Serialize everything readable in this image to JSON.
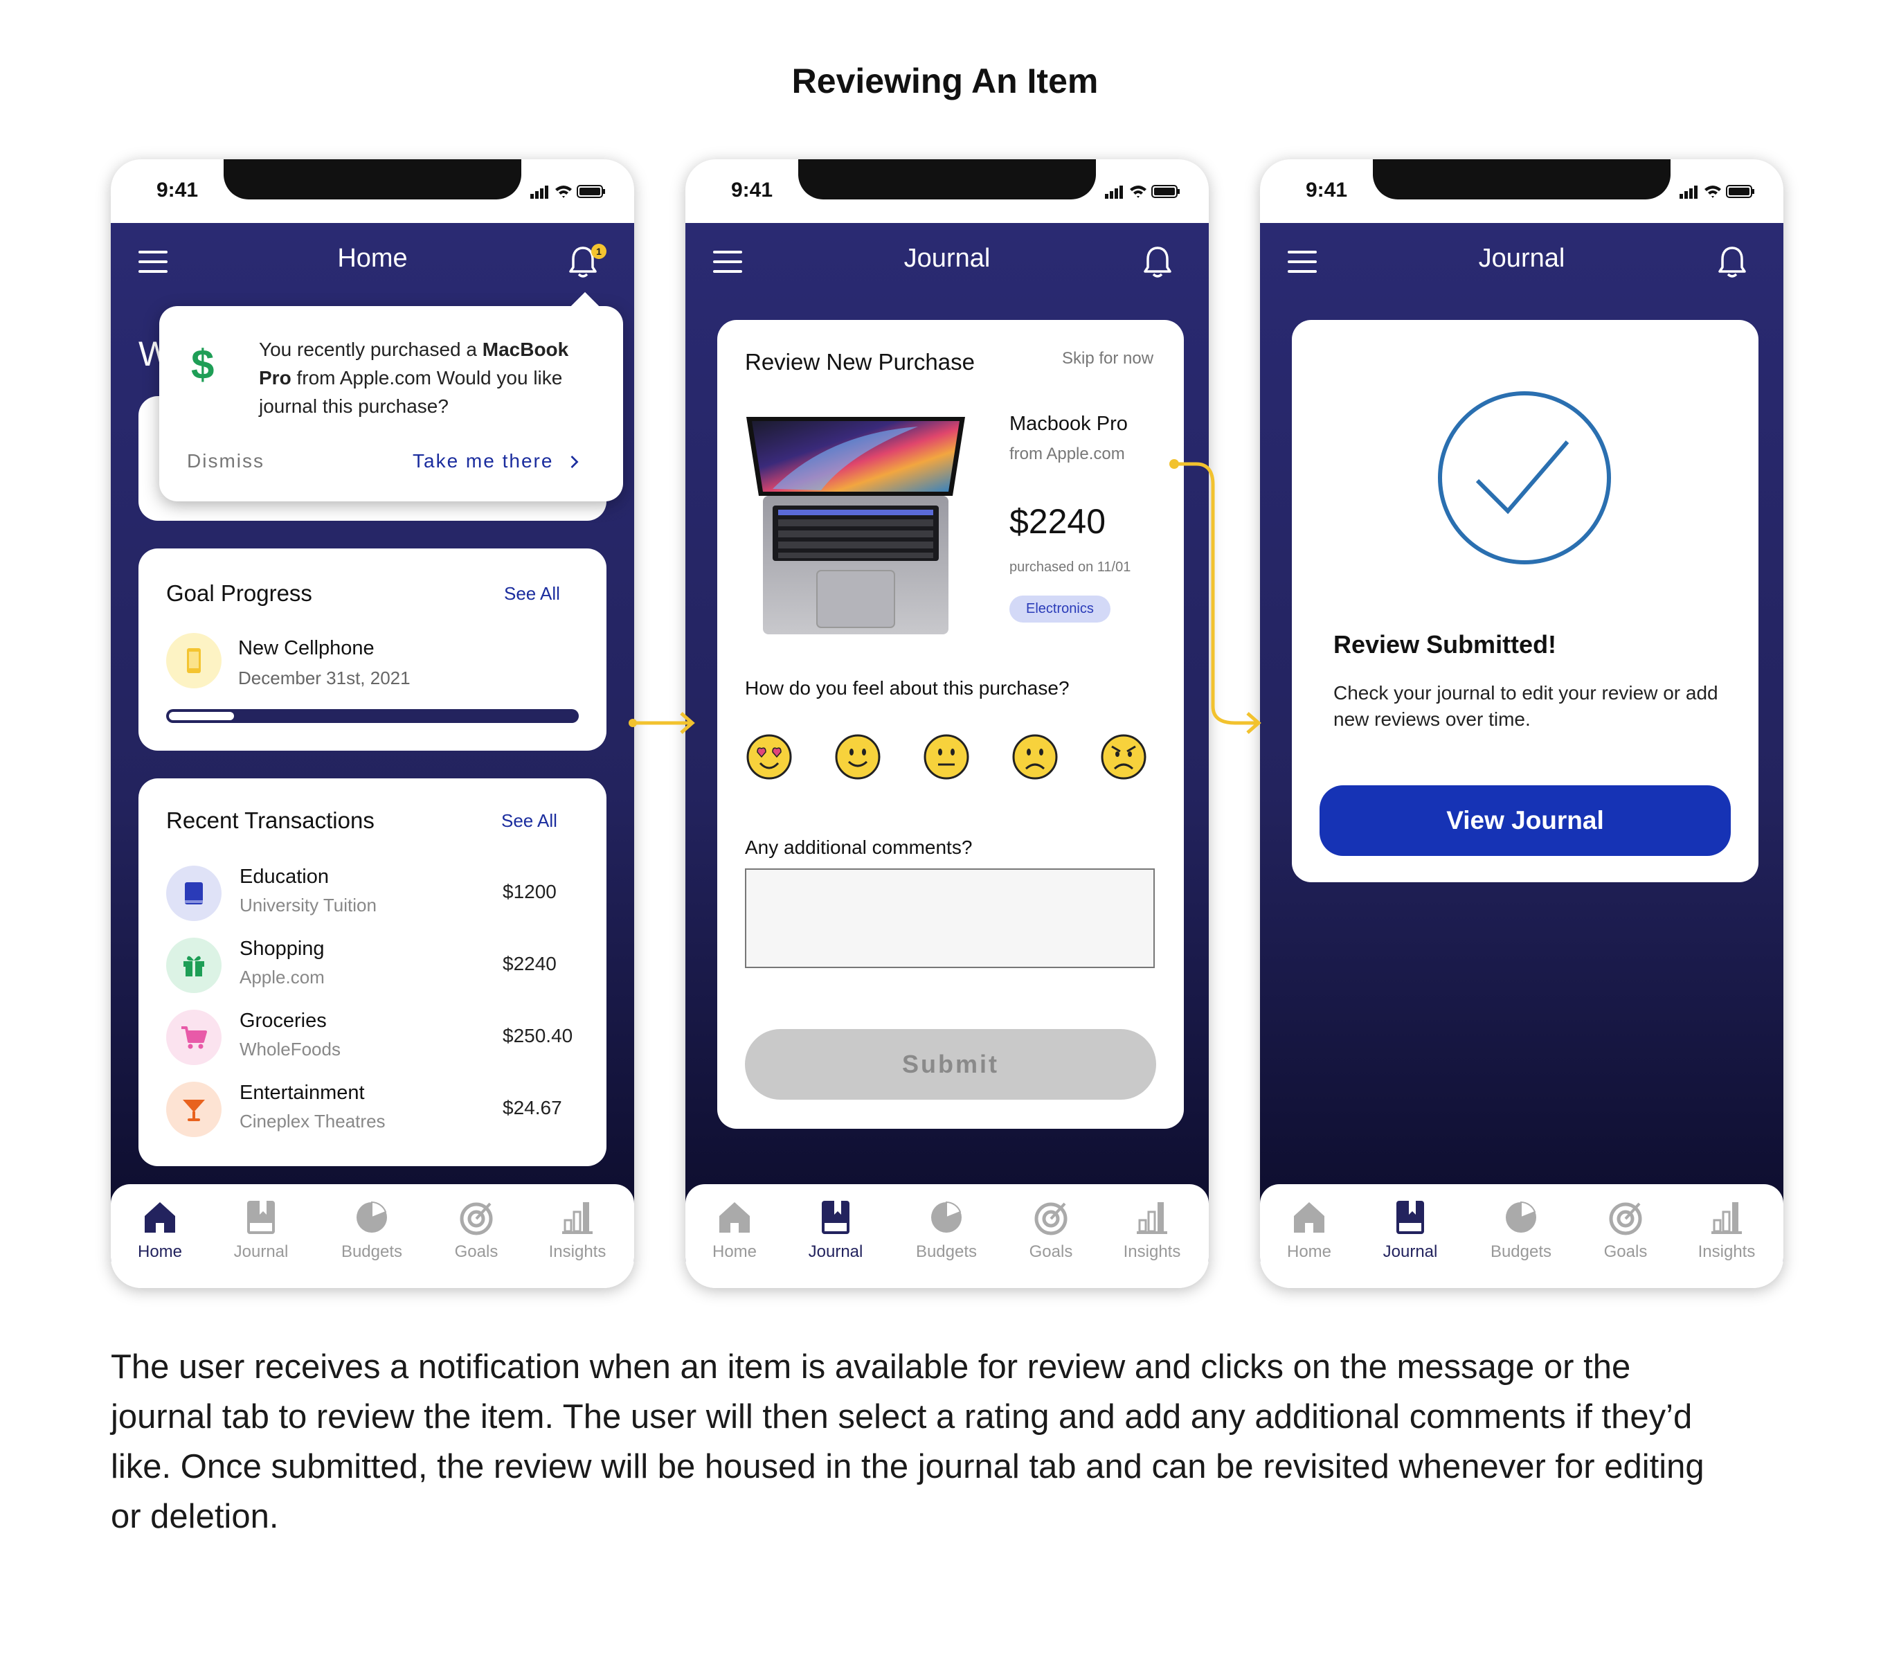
{
  "page": {
    "title": "Reviewing An Item",
    "caption": "The user receives a notification when an item is available for review and clicks on the message or the journal tab to review the item. The user will then select a rating and add any additional comments if they’d like. Once submitted, the review will be housed in the journal tab and can be revisited whenever for editing or deletion."
  },
  "status_time": "9:41",
  "tabs": [
    "Home",
    "Journal",
    "Budgets",
    "Goals",
    "Insights"
  ],
  "screen1": {
    "header": "Home",
    "badge_count": "1",
    "behind_letter": "W",
    "notification": {
      "prefix": "You recently purchased a ",
      "product": "MacBook Pro",
      "suffix": " from Apple.com Would you like journal this purchase?",
      "dismiss": "Dismiss",
      "action": "Take me there",
      "action_icon": "chevron-right-icon"
    },
    "goal": {
      "title": "Goal Progress",
      "see_all": "See All",
      "name": "New Cellphone",
      "date": "December 31st, 2021",
      "progress": 0.16,
      "icon": "phone-icon"
    },
    "transactions": {
      "title": "Recent Transactions",
      "see_all": "See All",
      "rows": [
        {
          "name": "Education",
          "sub": "University Tuition",
          "amount": "$1200",
          "icon": "book-icon",
          "color": "#2a3bb8",
          "bg": "#dfe2f7"
        },
        {
          "name": "Shopping",
          "sub": "Apple.com",
          "amount": "$2240",
          "icon": "gift-icon",
          "color": "#1e9e56",
          "bg": "#dcf3e5"
        },
        {
          "name": "Groceries",
          "sub": "WholeFoods",
          "amount": "$250.40",
          "icon": "cart-icon",
          "color": "#e85aa8",
          "bg": "#fbe3ef"
        },
        {
          "name": "Entertainment",
          "sub": "Cineplex Theatres",
          "amount": "$24.67",
          "icon": "cocktail-icon",
          "color": "#e8621e",
          "bg": "#fde3d3"
        }
      ]
    }
  },
  "screen2": {
    "header": "Journal",
    "title": "Review New Purchase",
    "skip": "Skip for now",
    "product": "Macbook Pro",
    "vendor": "from Apple.com",
    "price": "$2240",
    "purchase_date": "purchased on 11/01",
    "category": "Electronics",
    "question": "How do you feel about this purchase?",
    "ratings": [
      "love-emoji-icon",
      "smile-emoji-icon",
      "neutral-emoji-icon",
      "sad-emoji-icon",
      "angry-emoji-icon"
    ],
    "comments_label": "Any additional comments?",
    "comments_value": "",
    "submit": "Submit"
  },
  "screen3": {
    "header": "Journal",
    "title": "Review Submitted!",
    "body": "Check your journal to edit your review or add new reviews over time.",
    "button": "View Journal"
  },
  "colors": {
    "header_bg": "#2a2a72",
    "accent_blue": "#1633b5",
    "link_blue": "#1b2d9e",
    "arrow_yellow": "#f2c22e",
    "check_blue": "#2a6fb0"
  }
}
